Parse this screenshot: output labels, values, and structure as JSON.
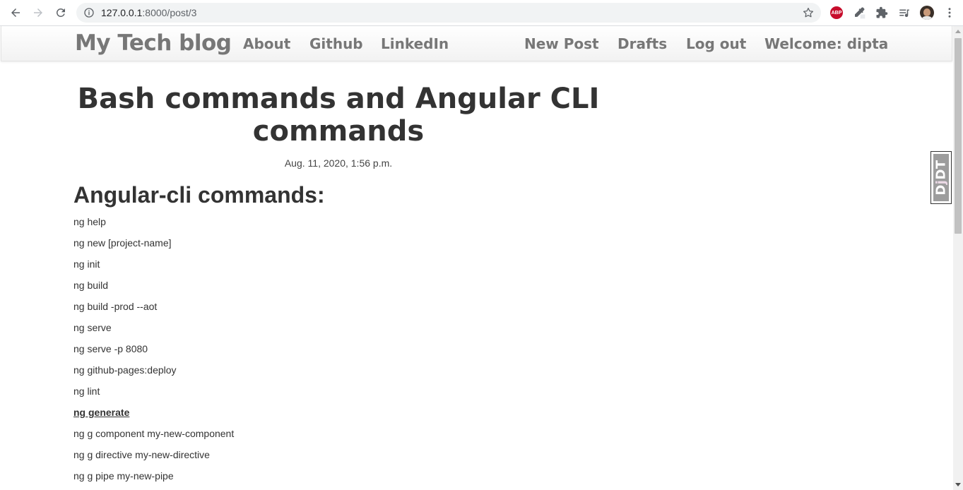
{
  "browser": {
    "url_host": "127.0.0.1",
    "url_rest": ":8000/post/3",
    "extensions": [
      "adblock-plus-icon",
      "eyedropper-icon",
      "extensions-puzzle-icon",
      "reading-list-icon"
    ]
  },
  "site": {
    "brand": "My Tech blog",
    "nav_left": [
      "About",
      "Github",
      "LinkedIn"
    ],
    "nav_right": [
      "New Post",
      "Drafts",
      "Log out",
      "Welcome: dipta"
    ]
  },
  "post": {
    "title": "Bash commands and Angular CLI commands",
    "date": "Aug. 11, 2020, 1:56 p.m.",
    "heading": "Angular-cli commands:",
    "commands": [
      "ng help",
      "ng new [project-name]",
      "ng init",
      "ng build",
      "ng build -prod --aot",
      "ng serve",
      "ng serve -p 8080",
      "ng github-pages:deploy",
      "ng lint",
      "ng generate",
      "ng g component my-new-component",
      "ng g directive my-new-directive",
      "ng g pipe my-new-pipe"
    ]
  },
  "djdt": {
    "label_d": "D",
    "label_j": "j",
    "label_dt": "DT"
  },
  "colors": {
    "nav_text": "#777777",
    "heading_text": "#333333",
    "abp_red": "#c70d2c"
  }
}
